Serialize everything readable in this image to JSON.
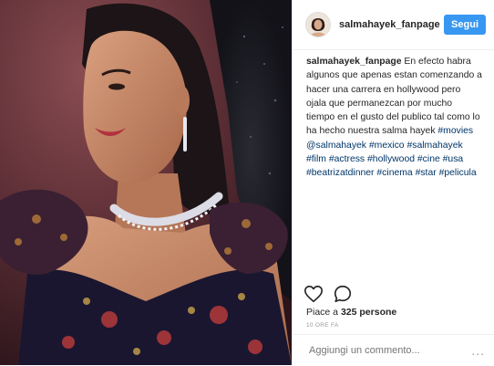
{
  "post": {
    "image_alt": "Salma Hayek on the red carpet",
    "username": "salmahayek_fanpage",
    "follow_label": "Segui",
    "caption": {
      "user": "salmahayek_fanpage",
      "text": " En efecto habra algunos que apenas estan comenzando a hacer una carrera en hollywood pero ojala que permanezcan por mucho tiempo en el gusto del publico tal como lo ha hecho nuestra salma hayek ",
      "tags": [
        "#movies",
        "@salmahayek",
        "#mexico",
        "#salmahayek",
        "#film",
        "#actress",
        "#hollywood",
        "#cine",
        "#usa",
        "#beatrizatdinner",
        "#cinema",
        "#star",
        "#pelicula"
      ]
    },
    "likes_prefix": "Piace a ",
    "likes_count": "325 persone",
    "timestamp": "10 ORE FA",
    "comment_placeholder": "Aggiungi un commento...",
    "more_label": "..."
  }
}
